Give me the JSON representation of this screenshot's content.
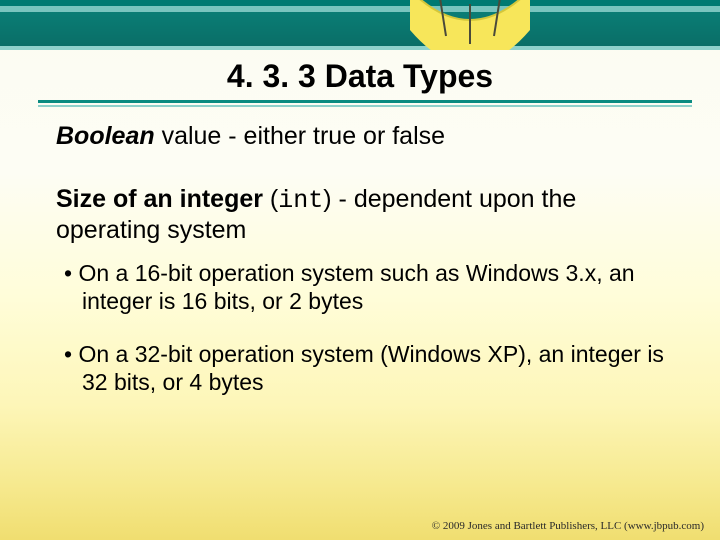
{
  "heading": "4. 3. 3 Data Types",
  "para1": {
    "bool": "Boolean",
    "rest": " value - either true or false"
  },
  "para2": {
    "label": "Size of an integer",
    "openparen": " (",
    "code": "int",
    "afterparen": ") - dependent upon the operating system"
  },
  "bullets": [
    "On a 16-bit operation system such as Windows 3.x, an integer is 16 bits, or 2 bytes",
    "On a 32-bit operation system (Windows XP), an integer is 32 bits, or 4 bytes"
  ],
  "footer": "© 2009 Jones and Bartlett Publishers, LLC (www.jbpub.com)"
}
